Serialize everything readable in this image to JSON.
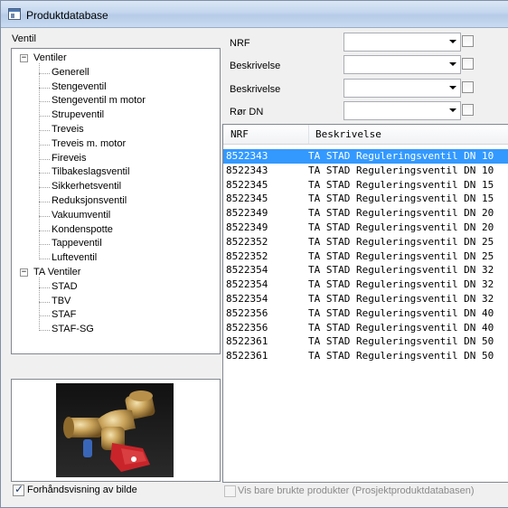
{
  "window": {
    "title": "Produktdatabase"
  },
  "left_panel": {
    "tree_label": "Ventil",
    "tree": {
      "groups": [
        {
          "label": "Ventiler",
          "expander": "−",
          "children": [
            "Generell",
            "Stengeventil",
            "Stengeventil m motor",
            "Strupeventil",
            "Treveis",
            "Treveis m. motor",
            "Fireveis",
            "Tilbakeslagsventil",
            "Sikkerhetsventil",
            "Reduksjonsventil",
            "Vakuumventil",
            "Kondenspotte",
            "Tappeventil",
            "Lufteventil"
          ]
        },
        {
          "label": "TA Ventiler",
          "expander": "−",
          "children": [
            "STAD",
            "TBV",
            "STAF",
            "STAF-SG"
          ]
        }
      ]
    },
    "preview": {
      "checkbox_label": "Forhåndsvisning av bilde",
      "checked": true
    }
  },
  "filters": [
    {
      "label": "NRF",
      "value": ""
    },
    {
      "label": "Beskrivelse",
      "value": ""
    },
    {
      "label": "Beskrivelse",
      "value": ""
    },
    {
      "label": "Rør DN",
      "value": ""
    }
  ],
  "grid": {
    "columns": [
      "NRF",
      "Beskrivelse"
    ],
    "selected_index": 0,
    "rows": [
      {
        "nrf": "8522343",
        "desc": "TA STAD Reguleringsventil DN 10"
      },
      {
        "nrf": "8522343",
        "desc": "TA STAD Reguleringsventil DN 10"
      },
      {
        "nrf": "8522345",
        "desc": "TA STAD Reguleringsventil DN 15"
      },
      {
        "nrf": "8522345",
        "desc": "TA STAD Reguleringsventil DN 15"
      },
      {
        "nrf": "8522349",
        "desc": "TA STAD Reguleringsventil DN 20"
      },
      {
        "nrf": "8522349",
        "desc": "TA STAD Reguleringsventil DN 20"
      },
      {
        "nrf": "8522352",
        "desc": "TA STAD Reguleringsventil DN 25"
      },
      {
        "nrf": "8522352",
        "desc": "TA STAD Reguleringsventil DN 25"
      },
      {
        "nrf": "8522354",
        "desc": "TA STAD Reguleringsventil DN 32"
      },
      {
        "nrf": "8522354",
        "desc": "TA STAD Reguleringsventil DN 32"
      },
      {
        "nrf": "8522354",
        "desc": "TA STAD Reguleringsventil DN 32"
      },
      {
        "nrf": "8522356",
        "desc": "TA STAD Reguleringsventil DN 40"
      },
      {
        "nrf": "8522356",
        "desc": "TA STAD Reguleringsventil DN 40"
      },
      {
        "nrf": "8522361",
        "desc": "TA STAD Reguleringsventil DN 50"
      },
      {
        "nrf": "8522361",
        "desc": "TA STAD Reguleringsventil DN 50"
      }
    ]
  },
  "footer": {
    "used_products_label": "Vis bare brukte produkter (Prosjektproduktdatabasen)",
    "checked": false,
    "disabled": true
  },
  "colors": {
    "selection": "#3399ff",
    "titlebar": "#c3d6ee"
  }
}
